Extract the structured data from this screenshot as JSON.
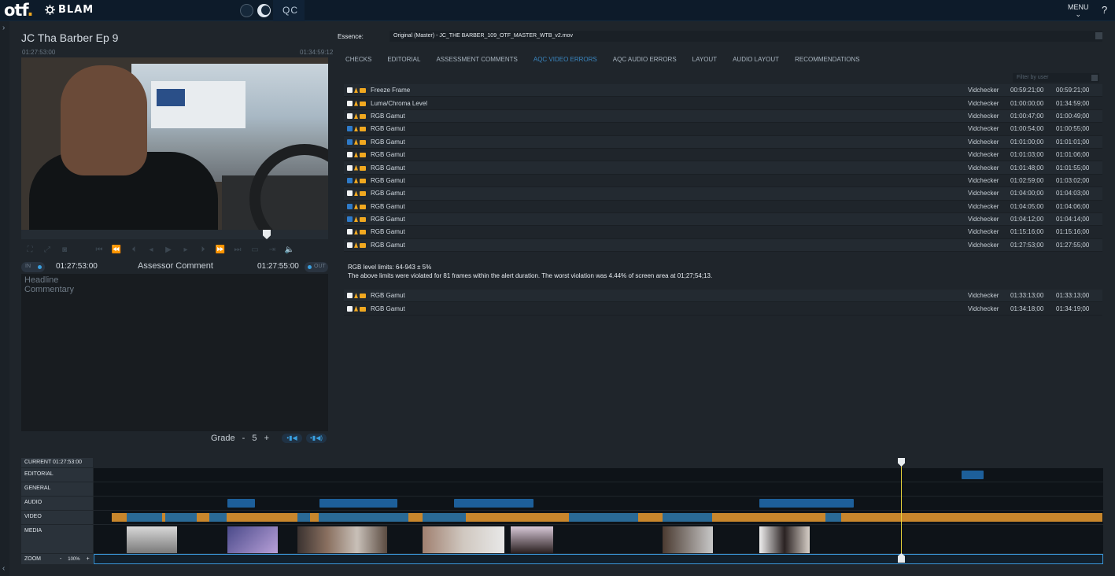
{
  "brand": {
    "logo": "otf",
    "product": "BLAM",
    "app": "QC"
  },
  "header": {
    "menu_label": "MENU",
    "help_label": "?"
  },
  "asset": {
    "title": "JC Tha Barber Ep 9",
    "tc_start": "01:27:53:00",
    "tc_end": "01:34:59:12"
  },
  "player": {
    "in_label": "IN",
    "in_tc": "01:27:53:00",
    "comment_label": "Assessor Comment",
    "out_tc": "01:27:55:00",
    "out_label": "OUT"
  },
  "comment": {
    "headline_placeholder": "Headline",
    "commentary_placeholder": "Commentary"
  },
  "grade": {
    "label": "Grade",
    "minus": "-",
    "value": "5",
    "plus": "+"
  },
  "essence": {
    "label": "Essence:",
    "value": "Original (Master) - JC_THE BARBER_109_OTF_MASTER_WTB_v2.mov"
  },
  "tabs": [
    "CHECKS",
    "EDITORIAL",
    "ASSESSMENT COMMENTS",
    "AQC VIDEO ERRORS",
    "AQC AUDIO ERRORS",
    "LAYOUT",
    "AUDIO LAYOUT",
    "RECOMMENDATIONS"
  ],
  "active_tab": "AQC VIDEO ERRORS",
  "filter": {
    "placeholder": "Filter by user"
  },
  "errors": [
    {
      "name": "Freeze Frame",
      "user": "Vidchecker",
      "start": "00:59:21;00",
      "end": "00:59:21;00",
      "checked": false
    },
    {
      "name": "Luma/Chroma Level",
      "user": "Vidchecker",
      "start": "01:00:00;00",
      "end": "01:34:59;00",
      "checked": false
    },
    {
      "name": "RGB Gamut",
      "user": "Vidchecker",
      "start": "01:00:47;00",
      "end": "01:00:49;00",
      "checked": false
    },
    {
      "name": "RGB Gamut",
      "user": "Vidchecker",
      "start": "01:00:54;00",
      "end": "01:00:55;00",
      "checked": true
    },
    {
      "name": "RGB Gamut",
      "user": "Vidchecker",
      "start": "01:01:00;00",
      "end": "01:01:01;00",
      "checked": true
    },
    {
      "name": "RGB Gamut",
      "user": "Vidchecker",
      "start": "01:01:03;00",
      "end": "01:01:06;00",
      "checked": false
    },
    {
      "name": "RGB Gamut",
      "user": "Vidchecker",
      "start": "01:01:48;00",
      "end": "01:01:55;00",
      "checked": false
    },
    {
      "name": "RGB Gamut",
      "user": "Vidchecker",
      "start": "01:02:59;00",
      "end": "01:03:02;00",
      "checked": true
    },
    {
      "name": "RGB Gamut",
      "user": "Vidchecker",
      "start": "01:04:00;00",
      "end": "01:04:03;00",
      "checked": false
    },
    {
      "name": "RGB Gamut",
      "user": "Vidchecker",
      "start": "01:04:05;00",
      "end": "01:04:06;00",
      "checked": true
    },
    {
      "name": "RGB Gamut",
      "user": "Vidchecker",
      "start": "01:04:12;00",
      "end": "01:04:14;00",
      "checked": true
    },
    {
      "name": "RGB Gamut",
      "user": "Vidchecker",
      "start": "01:15:16;00",
      "end": "01:15:16;00",
      "checked": false
    },
    {
      "name": "RGB Gamut",
      "user": "Vidchecker",
      "start": "01:27:53;00",
      "end": "01:27:55;00",
      "checked": false
    }
  ],
  "detail": {
    "line1": "RGB level limits: 64-943 ± 5%",
    "line2": "The above limits were violated for 81 frames within the alert duration. The worst violation was 4.44% of screen area at 01;27;54;13."
  },
  "errors_after": [
    {
      "name": "RGB Gamut",
      "user": "Vidchecker",
      "start": "01:33:13;00",
      "end": "01:33:13;00",
      "checked": false
    },
    {
      "name": "RGB Gamut",
      "user": "Vidchecker",
      "start": "01:34:18;00",
      "end": "01:34:19;00",
      "checked": false
    }
  ],
  "timeline": {
    "current_label": "CURRENT 01:27:53:00",
    "tracks": [
      "EDITORIAL",
      "GENERAL",
      "AUDIO",
      "VIDEO",
      "MEDIA"
    ],
    "zoom_label": "ZOOM",
    "zoom_minus": "-",
    "zoom_value": "100%",
    "zoom_plus": "+"
  },
  "colors": {
    "accent": "#3a86c0",
    "warning": "#f0a820",
    "video_track": "#c8862c",
    "segment": "#1d5f9a",
    "playhead": "#e6d23a"
  }
}
